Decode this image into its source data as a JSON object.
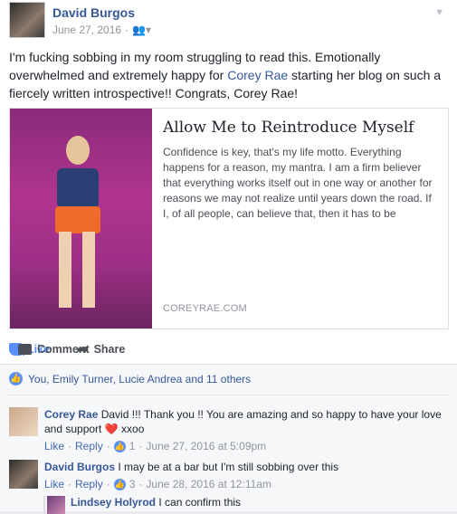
{
  "post": {
    "author": "David Burgos",
    "date": "June 27, 2016",
    "privacy_icon": "friends-icon",
    "menu_icon": "chevron-down-icon",
    "text_before": "I'm fucking sobbing in my room struggling to read this. Emotionally overwhelmed and extremely happy for ",
    "mention": "Corey Rae",
    "text_after": " starting her blog on such a fiercely written introspective!! Congrats, Corey Rae!"
  },
  "link_preview": {
    "title": "Allow Me to Reintroduce Myself",
    "description": "Confidence is key, that's my life motto. Everything happens for a reason, my mantra. I am a firm believer that everything works itself out in one way or another for reasons we may not realize until years down the road. If I, of all people, can believe that, then it has to be",
    "domain": "COREYRAE.COM"
  },
  "actions": {
    "like": "Like",
    "comment": "Comment",
    "share": "Share"
  },
  "reactions": {
    "summary": "You, Emily Turner, Lucie Andrea and 11 others"
  },
  "comments": [
    {
      "name": "Corey Rae",
      "text": "David !!! Thank you !! You are amazing and so happy to have your love and support",
      "emoji": "❤️",
      "text_end": " xxoo",
      "like": "Like",
      "reply": "Reply",
      "count": "1",
      "time": "June 27, 2016 at 5:09pm"
    },
    {
      "name": "David Burgos",
      "text": "I may be at a bar but I'm still sobbing over this",
      "like": "Like",
      "reply": "Reply",
      "count": "3",
      "time": "June 28, 2016 at 12:11am"
    }
  ],
  "reply": {
    "name": "Lindsey Holyrod",
    "text": "I can confirm this"
  },
  "colors": {
    "link": "#365899",
    "like_blue": "#5890ff",
    "heart": "#f0284a"
  }
}
